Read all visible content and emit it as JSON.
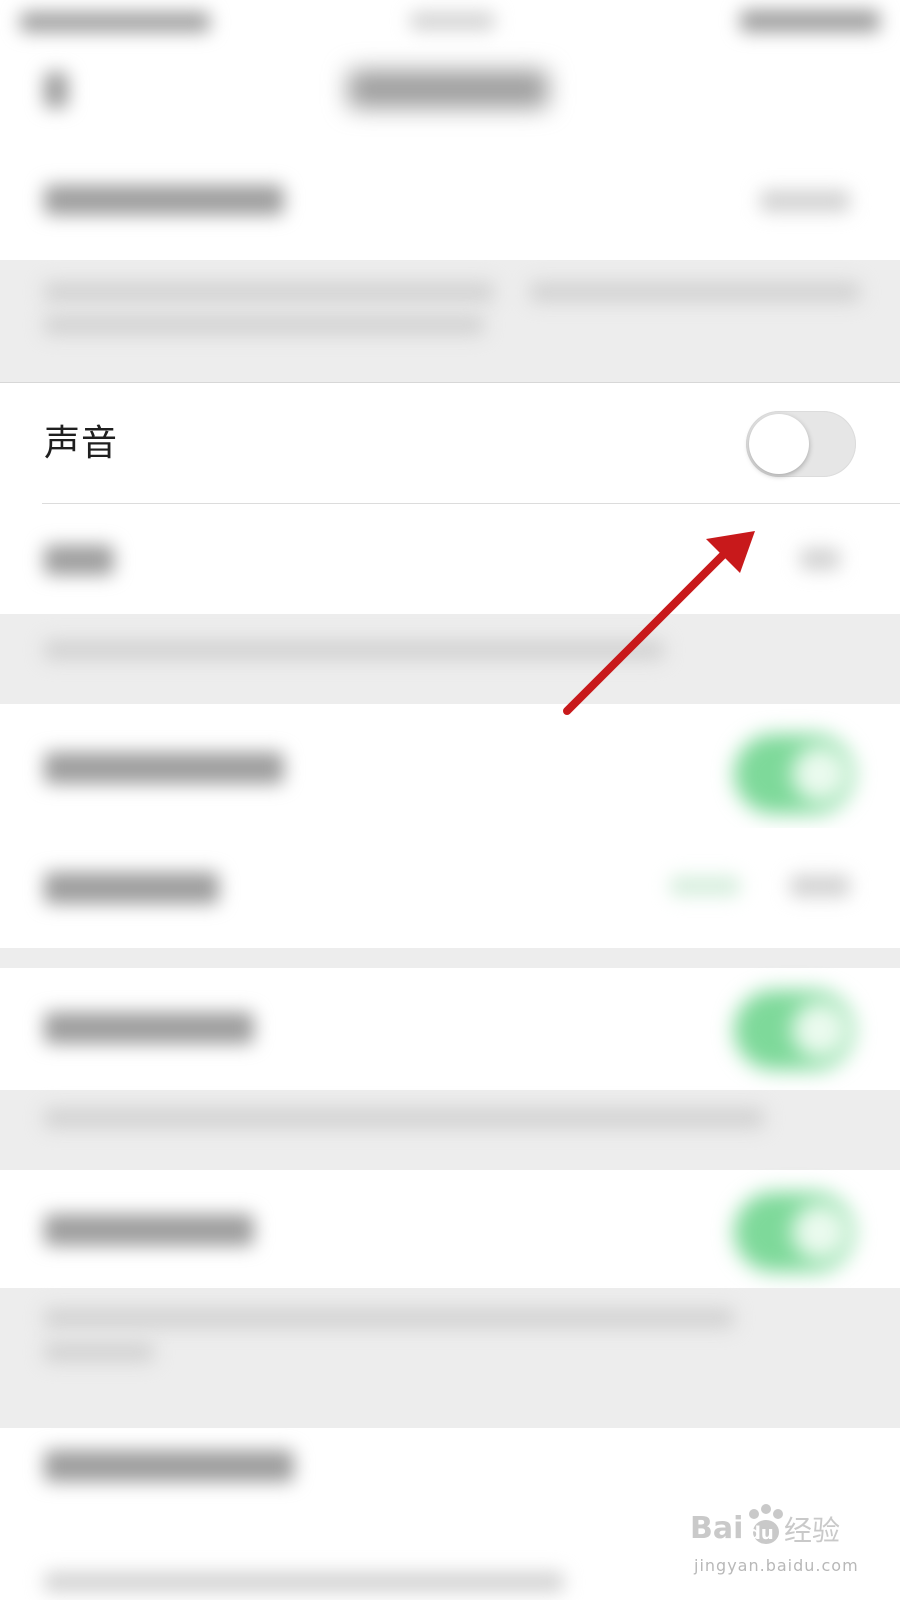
{
  "settings": {
    "sound_label": "声音",
    "sound_enabled": false
  },
  "watermark": {
    "brand": "Baidu经验",
    "url": "jingyan.baidu.com"
  }
}
